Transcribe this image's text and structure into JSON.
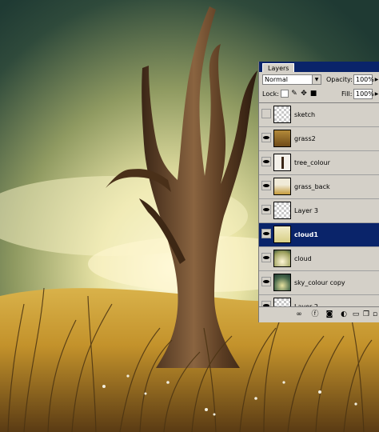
{
  "panel": {
    "tab_label": "Layers",
    "blend_mode": "Normal",
    "opacity_label": "Opacity:",
    "opacity_value": "100%",
    "lock_label": "Lock:",
    "fill_label": "Fill:",
    "fill_value": "100%"
  },
  "layers": [
    {
      "name": "sketch",
      "visible": false,
      "thumb": "checker"
    },
    {
      "name": "grass2",
      "visible": true,
      "thumb": "grass"
    },
    {
      "name": "tree_colour",
      "visible": true,
      "thumb": "tree"
    },
    {
      "name": "grass_back",
      "visible": true,
      "thumb": "grassback"
    },
    {
      "name": "Layer 3",
      "visible": true,
      "thumb": "checker"
    },
    {
      "name": "cloud1",
      "visible": true,
      "thumb": "cloudy",
      "selected": true
    },
    {
      "name": "cloud",
      "visible": true,
      "thumb": "cloud"
    },
    {
      "name": "sky_colour copy",
      "visible": true,
      "thumb": "sky"
    },
    {
      "name": "Layer 2",
      "visible": true,
      "thumb": "checker"
    }
  ],
  "icons": {
    "eye": "eye-icon",
    "link": "link-icon",
    "style": "layer-style-icon",
    "mask": "mask-icon",
    "adjust": "adjustment-icon",
    "folder": "folder-icon",
    "new": "new-layer-icon",
    "trash": "trash-icon"
  },
  "colors": {
    "selection": "#0a246a",
    "panel_bg": "#d4d0c8"
  }
}
